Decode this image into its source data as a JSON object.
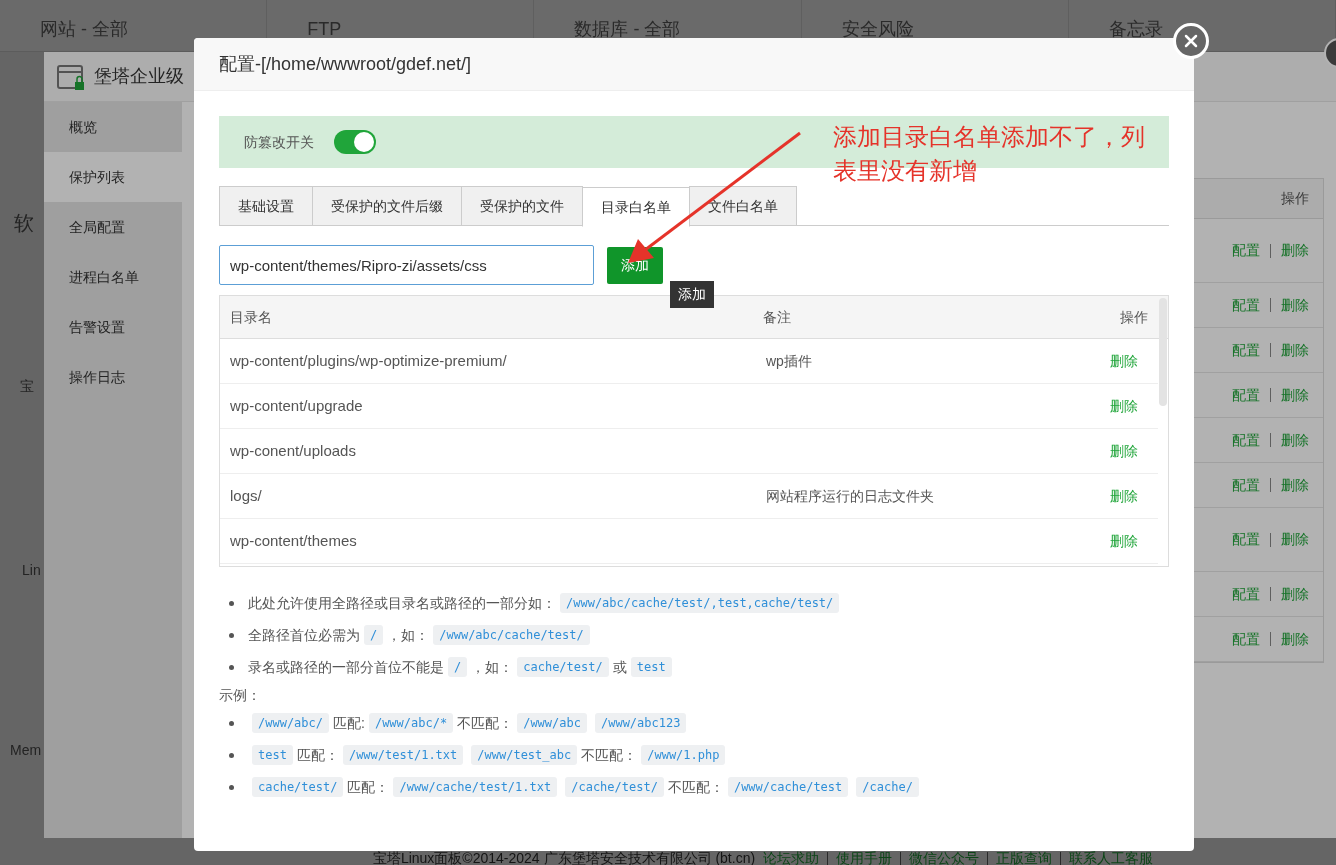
{
  "background_page": {
    "stats": [
      "网站 - 全部",
      "FTP",
      "数据库 - 全部",
      "安全风险",
      "备忘录"
    ],
    "side_labels": [
      "软",
      "宝",
      "Lin",
      "Mem"
    ],
    "footer": {
      "copyright": "宝塔Linux面板©2014-2024 广东堡塔安全技术有限公司 (bt.cn)",
      "links": [
        "论坛求助",
        "使用手册",
        "微信公众号",
        "正版查询",
        "联系人工客服"
      ]
    }
  },
  "plugin_window": {
    "title": "堡塔企业级",
    "menu": [
      {
        "label": "概览",
        "selected": false
      },
      {
        "label": "保护列表",
        "selected": true
      },
      {
        "label": "全局配置",
        "selected": false
      },
      {
        "label": "进程白名单",
        "selected": false
      },
      {
        "label": "告警设置",
        "selected": false
      },
      {
        "label": "操作日志",
        "selected": false
      }
    ],
    "table": {
      "header": "操作",
      "rows": [
        [
          "配置",
          "删除"
        ],
        [
          "配置",
          "删除"
        ],
        [
          "配置",
          "删除"
        ],
        [
          "配置",
          "删除"
        ],
        [
          "配置",
          "删除"
        ],
        [
          "配置",
          "删除"
        ],
        [
          "配置",
          "删除"
        ],
        [
          "配置",
          "删除"
        ],
        [
          "配置",
          "删除"
        ]
      ]
    }
  },
  "dialog": {
    "title": "配置-[/home/wwwroot/gdef.net/]",
    "switch": {
      "label": "防篡改开关",
      "on": true
    },
    "tabs": [
      {
        "label": "基础设置",
        "selected": false
      },
      {
        "label": "受保护的文件后缀",
        "selected": false
      },
      {
        "label": "受保护的文件",
        "selected": false
      },
      {
        "label": "目录白名单",
        "selected": true
      },
      {
        "label": "文件白名单",
        "selected": false
      }
    ],
    "input": {
      "value": "wp-content/themes/Ripro-zi/assets/css"
    },
    "add_button": "添加",
    "tooltip": "添加",
    "table": {
      "columns": [
        "目录名",
        "备注",
        "操作"
      ],
      "rows": [
        {
          "name": "wp-content/plugins/wp-optimize-premium/",
          "note": "wp插件",
          "action": "删除"
        },
        {
          "name": "wp-content/upgrade",
          "action": "删除"
        },
        {
          "name": "wp-conent/uploads",
          "action": "删除"
        },
        {
          "name": "logs/",
          "note": "网站程序运行的日志文件夹",
          "action": "删除"
        },
        {
          "name": "wp-content/themes",
          "action": "删除"
        }
      ]
    },
    "help": [
      [
        {
          "kind": "text",
          "text": "此处允许使用全路径或目录名或路径的一部分如："
        },
        {
          "kind": "code",
          "text": "/www/abc/cache/test/,test,cache/test/"
        }
      ],
      [
        {
          "kind": "text",
          "text": "全路径首位必需为"
        },
        {
          "kind": "code",
          "text": "/"
        },
        {
          "kind": "text",
          "text": "，如："
        },
        {
          "kind": "code",
          "text": "/www/abc/cache/test/"
        }
      ],
      [
        {
          "kind": "text",
          "text": "录名或路径的一部分首位不能是"
        },
        {
          "kind": "code",
          "text": "/"
        },
        {
          "kind": "text",
          "text": "，如："
        },
        {
          "kind": "code",
          "text": "cache/test/"
        },
        {
          "kind": "text",
          "text": "或"
        },
        {
          "kind": "code",
          "text": "test"
        }
      ]
    ],
    "example_label": "示例：",
    "examples": [
      [
        {
          "kind": "code",
          "text": "/www/abc/"
        },
        {
          "kind": "text",
          "text": "匹配:"
        },
        {
          "kind": "code",
          "text": "/www/abc/*"
        },
        {
          "kind": "text",
          "text": "不匹配："
        },
        {
          "kind": "code",
          "text": "/www/abc"
        },
        {
          "kind": "code",
          "text": "/www/abc123"
        }
      ],
      [
        {
          "kind": "code",
          "text": "test"
        },
        {
          "kind": "text",
          "text": "匹配："
        },
        {
          "kind": "code",
          "text": "/www/test/1.txt"
        },
        {
          "kind": "code",
          "text": "/www/test_abc"
        },
        {
          "kind": "text",
          "text": "不匹配："
        },
        {
          "kind": "code",
          "text": "/www/1.php"
        }
      ],
      [
        {
          "kind": "code",
          "text": "cache/test/"
        },
        {
          "kind": "text",
          "text": "匹配："
        },
        {
          "kind": "code",
          "text": "/www/cache/test/1.txt"
        },
        {
          "kind": "code",
          "text": "/cache/test/"
        },
        {
          "kind": "text",
          "text": "不匹配："
        },
        {
          "kind": "code",
          "text": "/www/cache/test"
        },
        {
          "kind": "code",
          "text": "/cache/"
        }
      ]
    ]
  },
  "annotation": {
    "text": "添加目录白名单添加不了，列表里没有新增"
  }
}
